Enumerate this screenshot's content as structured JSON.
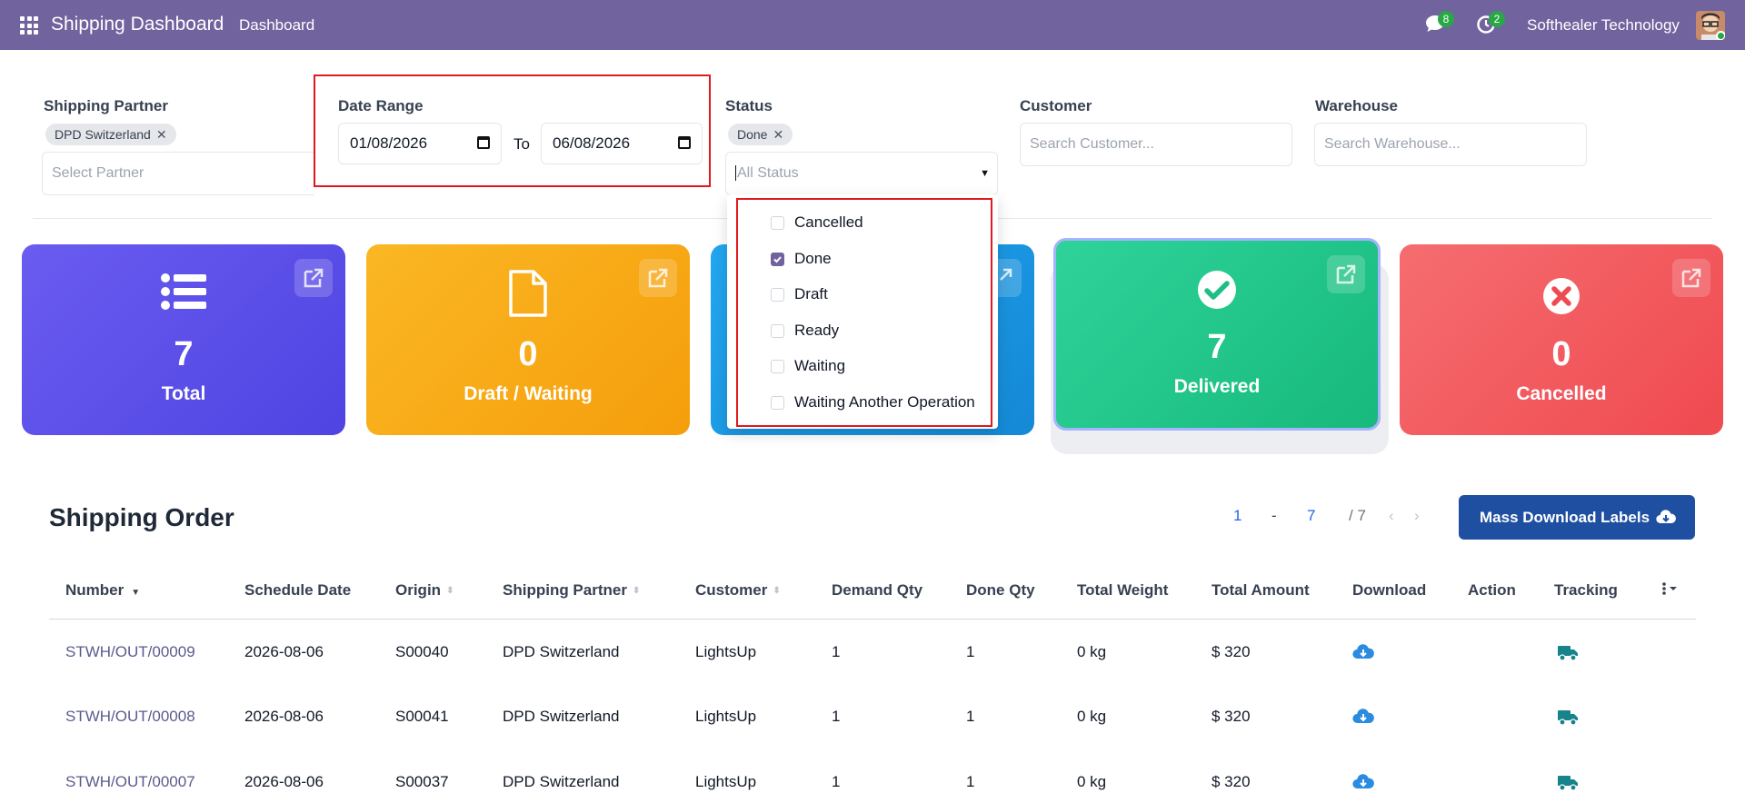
{
  "app": {
    "title": "Shipping Dashboard",
    "menu": "Dashboard",
    "company": "Softhealer Technology",
    "messages_count": "8",
    "activities_count": "2"
  },
  "filters": {
    "partner": {
      "label": "Shipping Partner",
      "tag": "DPD Switzerland",
      "placeholder": "Select Partner"
    },
    "date_range": {
      "label": "Date Range",
      "from": "01/08/2026",
      "to_label": "To",
      "to": "06/08/2026"
    },
    "status": {
      "label": "Status",
      "tag": "Done",
      "placeholder": "All Status",
      "options": [
        {
          "label": "Cancelled",
          "checked": false
        },
        {
          "label": "Done",
          "checked": true
        },
        {
          "label": "Draft",
          "checked": false
        },
        {
          "label": "Ready",
          "checked": false
        },
        {
          "label": "Waiting",
          "checked": false
        },
        {
          "label": "Waiting Another Operation",
          "checked": false
        }
      ]
    },
    "customer": {
      "label": "Customer",
      "placeholder": "Search Customer..."
    },
    "warehouse": {
      "label": "Warehouse",
      "placeholder": "Search Warehouse..."
    }
  },
  "cards": [
    {
      "value": "7",
      "label": "Total",
      "color": "#5b4ee6",
      "icon": "list-icon"
    },
    {
      "value": "0",
      "label": "Draft / Waiting",
      "color": "#f7a914",
      "icon": "document-icon"
    },
    {
      "value": "",
      "label": "",
      "color": "#1a96e0",
      "icon": ""
    },
    {
      "value": "7",
      "label": "Delivered",
      "color": "#22c489",
      "icon": "check-circle-icon"
    },
    {
      "value": "0",
      "label": "Cancelled",
      "color": "#f05a5e",
      "icon": "x-circle-icon"
    }
  ],
  "orders": {
    "title": "Shipping Order",
    "pager": {
      "start": "1",
      "sep": "-",
      "end": "7",
      "total": "/ 7"
    },
    "mass_download_label": "Mass Download Labels",
    "columns": [
      "Number",
      "Schedule Date",
      "Origin",
      "Shipping Partner",
      "Customer",
      "Demand Qty",
      "Done Qty",
      "Total Weight",
      "Total Amount",
      "Download",
      "Action",
      "Tracking"
    ],
    "rows": [
      {
        "number": "STWH/OUT/00009",
        "date": "2026-08-06",
        "origin": "S00040",
        "partner": "DPD Switzerland",
        "customer": "LightsUp",
        "demand": "1",
        "done": "1",
        "weight": "0 kg",
        "amount": "$ 320"
      },
      {
        "number": "STWH/OUT/00008",
        "date": "2026-08-06",
        "origin": "S00041",
        "partner": "DPD Switzerland",
        "customer": "LightsUp",
        "demand": "1",
        "done": "1",
        "weight": "0 kg",
        "amount": "$ 320"
      },
      {
        "number": "STWH/OUT/00007",
        "date": "2026-08-06",
        "origin": "S00037",
        "partner": "DPD Switzerland",
        "customer": "LightsUp",
        "demand": "1",
        "done": "1",
        "weight": "0 kg",
        "amount": "$ 320"
      }
    ]
  }
}
